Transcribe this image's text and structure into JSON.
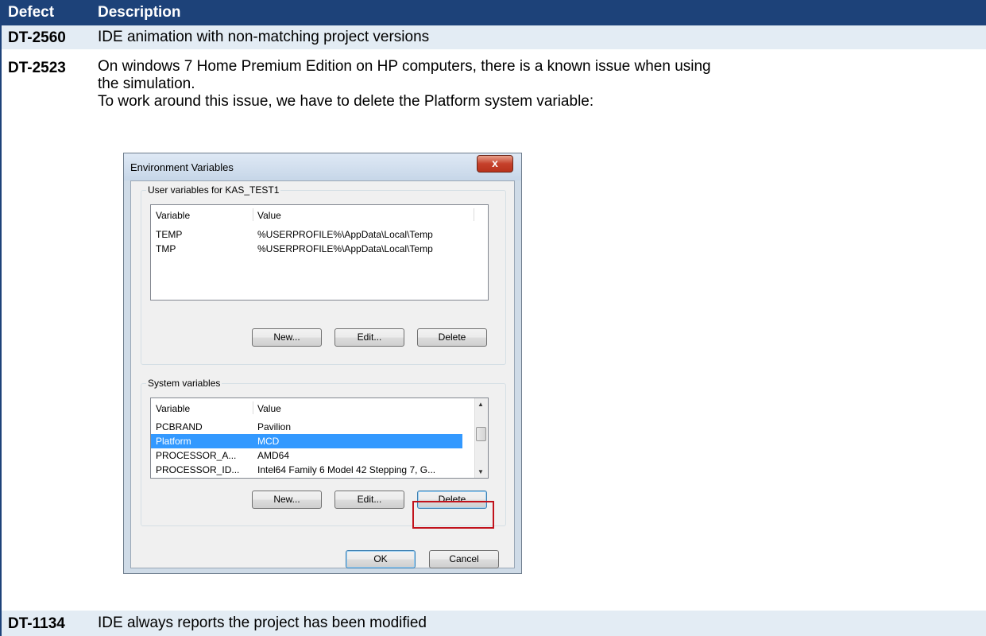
{
  "table": {
    "headers": {
      "defect": "Defect",
      "description": "Description"
    },
    "rows": [
      {
        "id": "DT-2560",
        "text": "IDE animation with non-matching project versions"
      },
      {
        "id": "DT-2523",
        "line1": "On windows 7 Home Premium Edition on HP computers, there is a known issue when using",
        "line2": "the simulation.",
        "line3": "To work around this issue, we have to delete the Platform system variable:"
      },
      {
        "id": "DT-1134",
        "text": "IDE always reports the project has been modified"
      }
    ]
  },
  "dialog": {
    "title": "Environment Variables",
    "close_label": "x",
    "user_group": {
      "label": "User variables for KAS_TEST1",
      "col_variable": "Variable",
      "col_value": "Value",
      "items": [
        {
          "variable": "TEMP",
          "value": "%USERPROFILE%\\AppData\\Local\\Temp"
        },
        {
          "variable": "TMP",
          "value": "%USERPROFILE%\\AppData\\Local\\Temp"
        }
      ],
      "new_label": "New...",
      "edit_label": "Edit...",
      "delete_label": "Delete"
    },
    "system_group": {
      "label": "System variables",
      "col_variable": "Variable",
      "col_value": "Value",
      "items": [
        {
          "variable": "PCBRAND",
          "value": "Pavilion"
        },
        {
          "variable": "Platform",
          "value": "MCD",
          "selected": true
        },
        {
          "variable": "PROCESSOR_A...",
          "value": "AMD64"
        },
        {
          "variable": "PROCESSOR_ID...",
          "value": "Intel64 Family 6 Model 42 Stepping 7, G..."
        }
      ],
      "new_label": "New...",
      "edit_label": "Edit...",
      "delete_label": "Delete"
    },
    "ok_label": "OK",
    "cancel_label": "Cancel"
  },
  "colors": {
    "header_bg": "#1d4279",
    "row_alt_bg": "#e3ecf4",
    "selection": "#3399ff",
    "highlight": "#c1121b"
  }
}
